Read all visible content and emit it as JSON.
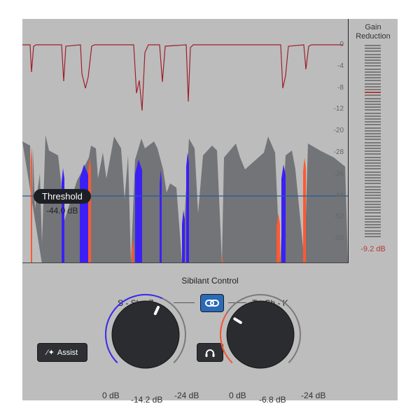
{
  "graph": {
    "axis_ticks": [
      "0",
      "-4",
      "-8",
      "-12",
      "-20",
      "-28",
      "-36",
      "-44",
      "-52",
      "-60"
    ],
    "threshold_label": "Threshold",
    "threshold_value": "-44.0 dB"
  },
  "meter": {
    "title": "Gain Reduction",
    "value": "-9.2 dB",
    "level_db": -9.2
  },
  "controls": {
    "title": "Sibilant Control",
    "left_band": "S - Sh - Z",
    "right_band": "T - Ch - K",
    "link_icon": "link-icon",
    "assist_label": "Assist",
    "assist_icon": "magic-wand-icon",
    "listen_icon": "headphones-icon",
    "knob_left": {
      "min_label": "0 dB",
      "max_label": "-24 dB",
      "value_label": "-14.2 dB",
      "value": -14.2,
      "color": "#3b2cf0"
    },
    "knob_right": {
      "min_label": "0 dB",
      "max_label": "-24 dB",
      "value_label": "-6.8 dB",
      "value": -6.8,
      "color": "#ff5533"
    }
  },
  "colors": {
    "gain_curve": "#9e1f2b",
    "waveform": "#727478",
    "sibilant_s": "#3b20f5",
    "sibilant_t": "#ff5a30",
    "threshold_line": "#2a5a9a",
    "link_active": "#2a6ab8"
  }
}
